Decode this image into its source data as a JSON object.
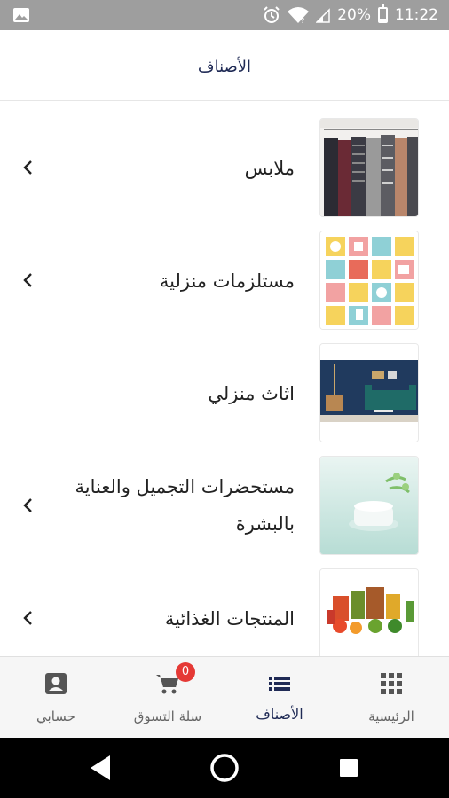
{
  "status_bar": {
    "battery_text": "20%",
    "time": "11:22"
  },
  "header": {
    "title": "الأصناف"
  },
  "categories": [
    {
      "label": "ملابس",
      "image": "clothes-rack-photo"
    },
    {
      "label": "مستلزمات منزلية",
      "image": "household-items-grid-photo"
    },
    {
      "label": "اثاث منزلي",
      "image": "living-room-furniture-photo"
    },
    {
      "label": "مستحضرات التجميل والعناية بالبشرة",
      "image": "skincare-cream-jar-photo"
    },
    {
      "label": "المنتجات الغذائية",
      "image": "groceries-basket-photo"
    }
  ],
  "bottom_nav": {
    "items": [
      {
        "label": "الرئيسية",
        "icon": "grid-apps-icon"
      },
      {
        "label": "الأصناف",
        "icon": "list-icon",
        "active": true
      },
      {
        "label": "سلة التسوق",
        "icon": "shopping-cart-icon",
        "badge": "0"
      },
      {
        "label": "حسابي",
        "icon": "account-box-icon"
      }
    ]
  },
  "colors": {
    "accent": "#1f2a55",
    "badge": "#e53935",
    "status_bar": "#9e9e9e",
    "bottom_nav_bg": "#f6f6f6"
  }
}
